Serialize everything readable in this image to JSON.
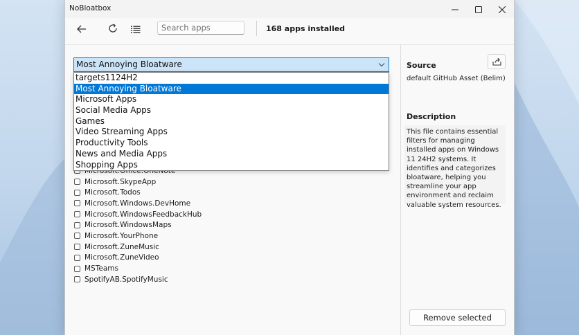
{
  "window": {
    "title": "NoBloatbox",
    "minimize_icon": "minimize-icon",
    "maximize_icon": "maximize-icon",
    "close_icon": "close-icon"
  },
  "toolbar": {
    "back_icon": "back-arrow-icon",
    "refresh_icon": "refresh-icon",
    "list_icon": "list-icon",
    "search_placeholder": "Search apps",
    "apps_count": "168 apps installed"
  },
  "filter": {
    "selected": "Most Annoying Bloatware",
    "chevron_icon": "chevron-down-icon",
    "options": [
      {
        "label": "targets1124H2",
        "selected": false
      },
      {
        "label": "Most Annoying Bloatware",
        "selected": true
      },
      {
        "label": "Microsoft Apps",
        "selected": false
      },
      {
        "label": "Social Media Apps",
        "selected": false
      },
      {
        "label": "Games",
        "selected": false
      },
      {
        "label": "Video Streaming Apps",
        "selected": false
      },
      {
        "label": "Productivity Tools",
        "selected": false
      },
      {
        "label": "News and Media Apps",
        "selected": false
      },
      {
        "label": "Shopping Apps",
        "selected": false
      }
    ]
  },
  "apps": [
    {
      "name": "Microsoft.Office.OneNote",
      "checked": false
    },
    {
      "name": "Microsoft.SkypeApp",
      "checked": false
    },
    {
      "name": "Microsoft.Todos",
      "checked": false
    },
    {
      "name": "Microsoft.Windows.DevHome",
      "checked": false
    },
    {
      "name": "Microsoft.WindowsFeedbackHub",
      "checked": false
    },
    {
      "name": "Microsoft.WindowsMaps",
      "checked": false
    },
    {
      "name": "Microsoft.YourPhone",
      "checked": false
    },
    {
      "name": "Microsoft.ZuneMusic",
      "checked": false
    },
    {
      "name": "Microsoft.ZuneVideo",
      "checked": false
    },
    {
      "name": "MSTeams",
      "checked": false
    },
    {
      "name": "SpotifyAB.SpotifyMusic",
      "checked": false
    }
  ],
  "side": {
    "source_heading": "Source",
    "share_icon": "share-icon",
    "source_value": "default GitHub Asset (Belim)",
    "description_heading": "Description",
    "description": "This file contains essential filters for managing installed apps on Windows 11 24H2 systems. It identifies and categorizes bloatware, helping you streamline your app environment and reclaim valuable system resources.",
    "remove_label": "Remove selected"
  },
  "colors": {
    "accent": "#0078d7",
    "select_bg": "#cce4f7"
  }
}
